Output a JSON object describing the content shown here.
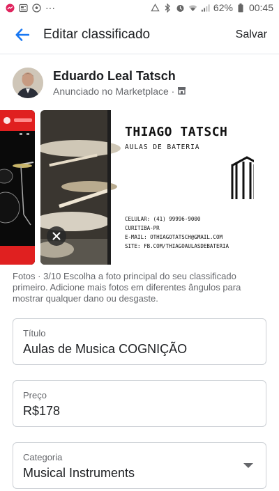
{
  "status_bar": {
    "left_icons": [
      "messenger-icon",
      "news-icon",
      "soccer-ball-icon"
    ],
    "more": "···",
    "battery": "62%",
    "time": "00:45"
  },
  "header": {
    "title": "Editar classificado",
    "save_label": "Salvar"
  },
  "profile": {
    "name": "Eduardo Leal Tatsch",
    "subtitle": "Anunciado no Marketplace ·"
  },
  "photo_ad": {
    "title": "THIAGO TATSCH",
    "subtitle": "AULAS DE BATERIA",
    "lines": [
      "CELULAR: (41) 99996-9000",
      "CURITIBA-PR",
      "E-MAIL: OTHIAGOTATSCH@GMAIL.COM",
      "SITE: FB.COM/THIAGOAULASDEBATERIA"
    ]
  },
  "caption": {
    "count": "Fotos · 3/10",
    "text": " Escolha a foto principal do seu classificado primeiro. Adicione mais fotos em diferentes ângulos para mostrar qualquer dano ou desgaste."
  },
  "fields": {
    "title": {
      "label": "Título",
      "value": "Aulas de Musica COGNIÇÃO"
    },
    "price": {
      "label": "Preço",
      "value": "R$178"
    },
    "category": {
      "label": "Categoria",
      "value": "Musical Instruments"
    }
  },
  "colors": {
    "accent": "#1877f2",
    "text": "#1c1e21",
    "secondary": "#65676b",
    "border": "#ccd0d5"
  }
}
